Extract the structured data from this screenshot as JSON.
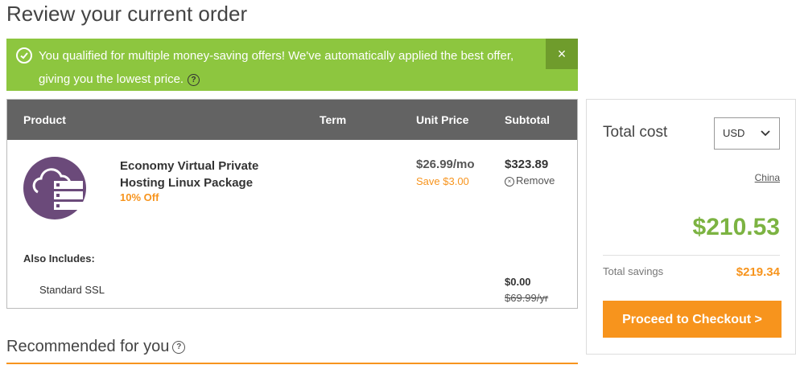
{
  "page": {
    "title": "Review your current order"
  },
  "banner": {
    "message_line1": "You qualified for multiple money-saving offers! We've automatically applied the best offer,",
    "message_line2": "giving you the lowest price.",
    "help_glyph": "?",
    "close_glyph": "×",
    "icons": {
      "status": "check-circle-icon",
      "help": "help-icon",
      "close": "close-icon"
    },
    "color": "#8dc63f"
  },
  "table": {
    "headers": {
      "product": "Product",
      "term": "Term",
      "unit_price": "Unit Price",
      "subtotal": "Subtotal"
    },
    "header_color": "#636363",
    "item": {
      "icon": "cloud-server-icon",
      "name": "Economy Virtual Private Hosting Linux Package",
      "discount": "10% Off",
      "unit_price": "$26.99/mo",
      "save": "Save $3.00",
      "subtotal": "$323.89",
      "remove_label": "Remove",
      "remove_glyph": "×"
    },
    "also_includes": {
      "label": "Also Includes:",
      "items": [
        {
          "name": "Standard SSL",
          "price": "$0.00",
          "original_price": "$69.99/yr"
        }
      ]
    }
  },
  "recommended": {
    "title": "Recommended for you",
    "help_glyph": "?"
  },
  "summary": {
    "total_cost_label": "Total cost",
    "currency": "USD",
    "region": "China",
    "total": "$210.53",
    "savings_label": "Total savings",
    "savings": "$219.34",
    "checkout_label": "Proceed to Checkout >"
  },
  "colors": {
    "accent_orange": "#f7941d",
    "total_green": "#7cb342",
    "product_purple": "#6b4a7a"
  }
}
